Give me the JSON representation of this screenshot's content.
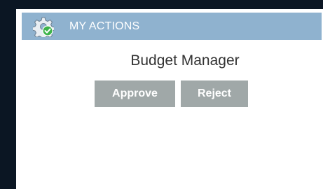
{
  "panel": {
    "title": "MY ACTIONS",
    "icon": "gear-check-icon",
    "role": "Budget Manager"
  },
  "actions": {
    "approve_label": "Approve",
    "reject_label": "Reject"
  },
  "colors": {
    "header_bg": "#8fb2cf",
    "button_bg": "#a0a8a8",
    "page_bg": "#0b1623",
    "badge_green": "#3db34a"
  }
}
